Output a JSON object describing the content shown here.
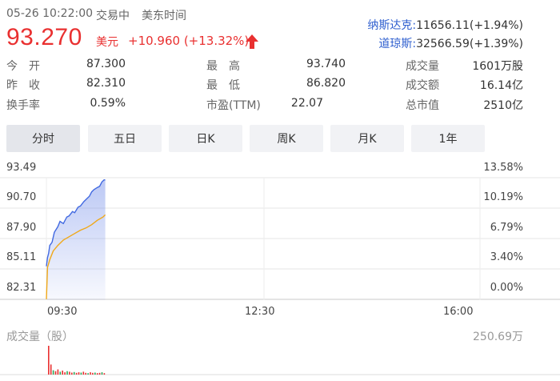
{
  "header": {
    "datetime": "05-26 10:22:00",
    "status": "交易中",
    "timezone": "美东时间",
    "price": "93.270",
    "currency": "美元",
    "change": "+10.960 (+13.32%)",
    "colors": {
      "up": "#e93030",
      "index": "#2f5fcf"
    }
  },
  "indices": [
    {
      "name": "纳斯达克:",
      "value": "11656.11(+1.94%)"
    },
    {
      "name": "道琼斯:",
      "value": "32566.59(+1.39%)"
    }
  ],
  "quote": {
    "open_label": "今　开",
    "open": "87.300",
    "high_label": "最　高",
    "high": "93.740",
    "volume_label": "成交量",
    "volume": "1601万股",
    "prev_label": "昨　收",
    "prev": "82.310",
    "low_label": "最　低",
    "low": "86.820",
    "amount_label": "成交额",
    "amount": "16.14亿",
    "turnover_label": "换手率",
    "turnover": "0.59%",
    "pe_label": "市盈(TTM)",
    "pe": "22.07",
    "mcap_label": "总市值",
    "mcap": "2510亿"
  },
  "tabs": [
    "分时",
    "五日",
    "日K",
    "周K",
    "月K",
    "1年"
  ],
  "active_tab": 0,
  "chart_data": {
    "type": "line",
    "y_price_ticks": [
      "93.49",
      "90.70",
      "87.90",
      "85.11",
      "82.31"
    ],
    "y_pct_ticks": [
      "13.58%",
      "10.19%",
      "6.79%",
      "3.40%",
      "0.00%"
    ],
    "x_ticks": [
      "09:30",
      "12:30",
      "16:00"
    ],
    "ylim": [
      82.31,
      93.49
    ],
    "series": [
      {
        "color": "#4169e1",
        "x": [
          "09:30",
          "09:31",
          "09:32",
          "09:33",
          "09:35",
          "09:37",
          "09:40",
          "09:42",
          "09:45",
          "09:48",
          "09:50",
          "09:53",
          "09:55",
          "09:58",
          "10:00",
          "10:03",
          "10:05",
          "10:08",
          "10:10",
          "10:12",
          "10:15",
          "10:17",
          "10:19",
          "10:21",
          "10:22"
        ],
        "values": [
          85.4,
          86.2,
          86.6,
          87.3,
          87.6,
          88.5,
          89.0,
          89.5,
          89.3,
          89.9,
          90.0,
          90.4,
          90.3,
          90.8,
          90.9,
          91.3,
          91.5,
          91.8,
          92.2,
          92.4,
          92.6,
          92.7,
          93.1,
          93.3,
          93.27
        ]
      },
      {
        "color": "#f0a818",
        "x": [
          "09:30",
          "09:31",
          "09:33",
          "09:36",
          "09:40",
          "09:45",
          "09:50",
          "09:55",
          "10:00",
          "10:05",
          "10:10",
          "10:15",
          "10:20",
          "10:22"
        ],
        "values": [
          82.4,
          85.3,
          86.0,
          86.8,
          87.3,
          87.8,
          88.1,
          88.4,
          88.7,
          88.9,
          89.2,
          89.6,
          89.9,
          90.1
        ]
      }
    ]
  },
  "volume": {
    "label": "成交量（股）",
    "max_label": "250.69万",
    "bars_up": [
      1.0,
      0.35,
      0.15,
      0.12,
      0.18,
      0.1,
      0.14,
      0.08,
      0.12,
      0.1,
      0.07,
      0.09,
      0.06,
      0.08,
      0.07,
      0.1,
      0.06,
      0.05,
      0.08,
      0.06,
      0.07,
      0.05,
      0.06,
      0.08,
      0.05
    ],
    "colors": {
      "up": "#e93030",
      "down": "#2ca85a"
    }
  }
}
